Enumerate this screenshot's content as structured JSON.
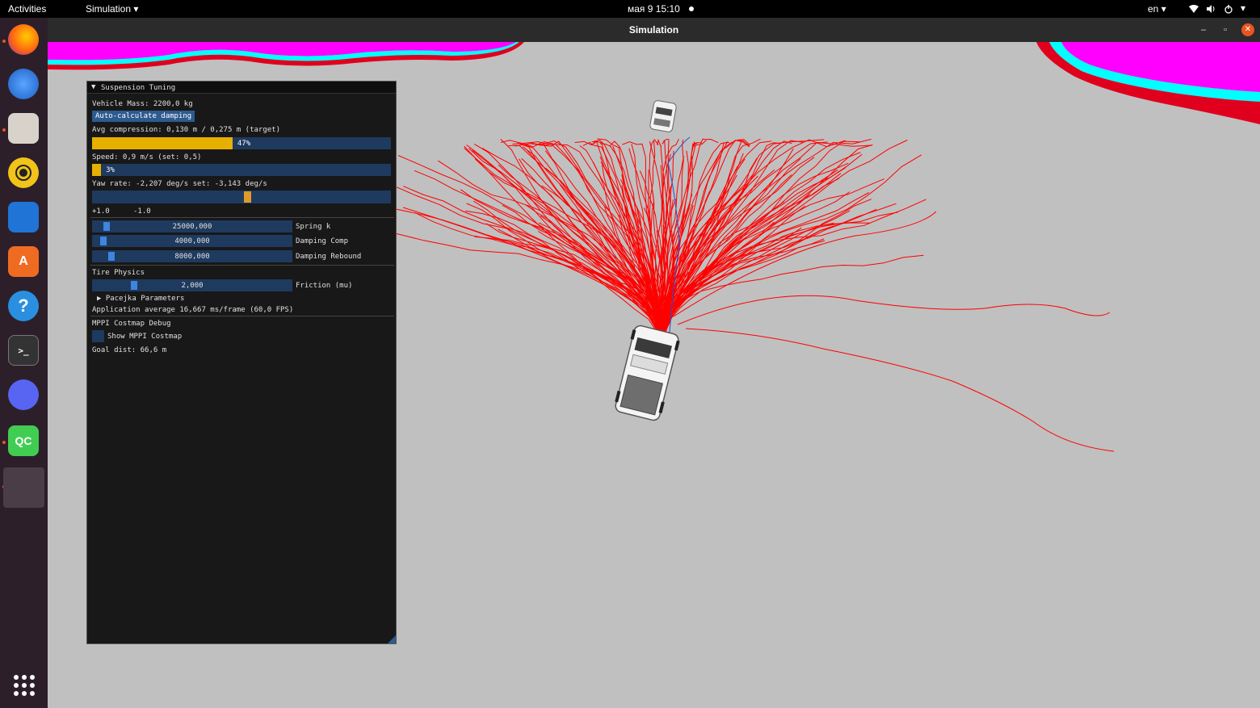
{
  "topbar": {
    "activities": "Activities",
    "app_menu": "Simulation",
    "clock": "мая 9  15:10",
    "lang": "en"
  },
  "dock": {
    "items": [
      {
        "name": "firefox",
        "running": true
      },
      {
        "name": "thunderbird",
        "running": false
      },
      {
        "name": "files",
        "running": true
      },
      {
        "name": "rhythmbox",
        "running": false
      },
      {
        "name": "libreoffice-writer",
        "running": false
      },
      {
        "name": "app-center",
        "running": false
      },
      {
        "name": "help",
        "running": false
      },
      {
        "name": "terminal",
        "running": false
      },
      {
        "name": "discord",
        "running": false
      },
      {
        "name": "qt-creator",
        "running": true,
        "label": "QC"
      },
      {
        "name": "simulation",
        "running": true
      }
    ]
  },
  "window": {
    "title": "Simulation"
  },
  "panel": {
    "title": "Suspension Tuning",
    "vehicle_mass": "Vehicle Mass: 2200,0 kg",
    "auto_button": "Auto-calculate damping",
    "avg_compression": "Avg compression: 0,130 m / 0,275 m (target)",
    "compression_progress": 0.47,
    "compression_label": "47%",
    "speed": "Speed: 0,9 m/s (set: 0,5)",
    "speed_progress": 0.03,
    "speed_label": "3%",
    "yaw_rate": "Yaw rate: -2,207 deg/s set: -3,143 deg/s",
    "yaw_slider": 0.52,
    "yaw_left": "+1.0",
    "yaw_right": "-1.0",
    "spring_value": "25000,000",
    "spring_label": "Spring k",
    "damp_comp_value": "4000,000",
    "damp_comp_label": "Damping Comp",
    "damp_rebound_value": "8000,000",
    "damp_rebound_label": "Damping Rebound",
    "tire_header": "Tire Physics",
    "friction_value": "2,000",
    "friction_label": "Friction (mu)",
    "pacejka": "Pacejka Parameters",
    "app_average": "Application average 16,667 ms/frame (60,0 FPS)",
    "costmap_header": "MPPI Costmap Debug",
    "show_costmap": "Show MPPI Costmap",
    "goal_dist": "Goal dist: 66,6 m"
  },
  "colors": {
    "trajectory": "#ff0000",
    "obstacle": "#ff00ff",
    "obstacle_edge": "#00ffff",
    "ground": "#c0c0c0",
    "bar_fill": "#e6b000"
  }
}
